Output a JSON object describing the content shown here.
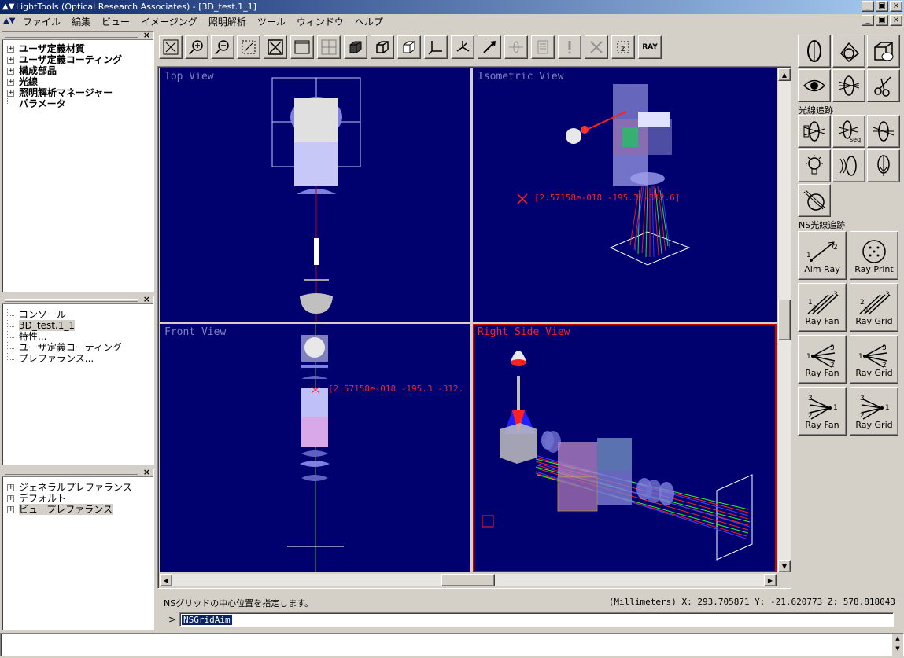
{
  "window": {
    "title": "LightTools (Optical Research Associates) - [3D_test.1_1]",
    "controls": [
      "_",
      "▣",
      "×"
    ]
  },
  "menu": [
    "ファイル",
    "編集",
    "ビュー",
    "イメージング",
    "照明解析",
    "ツール",
    "ウィンドウ",
    "ヘルプ"
  ],
  "tree_top": [
    {
      "label": "ユーザ定義材質",
      "expander": "+",
      "bold": true
    },
    {
      "label": "ユーザ定義コーティング",
      "expander": "+",
      "bold": true
    },
    {
      "label": "構成部品",
      "expander": "+",
      "bold": true
    },
    {
      "label": "光線",
      "expander": "+",
      "bold": true
    },
    {
      "label": "照明解析マネージャー",
      "expander": "+",
      "bold": true
    },
    {
      "label": "パラメータ",
      "expander": "",
      "bold": true
    }
  ],
  "tree_mid": [
    {
      "label": "コンソール"
    },
    {
      "label": "3D_test.1_1"
    },
    {
      "label": "特性..."
    },
    {
      "label": "ユーザ定義コーティング"
    },
    {
      "label": "プレファランス..."
    }
  ],
  "tree_bottom": [
    {
      "label": "ジェネラルプレファランス",
      "expander": "+"
    },
    {
      "label": "デフォルト",
      "expander": "+"
    },
    {
      "label": "ビュープレファランス",
      "expander": "+"
    }
  ],
  "toolbar_icons": [
    "zoom-fit-icon",
    "zoom-in-icon",
    "zoom-out-icon",
    "zoom-window-icon",
    "zoom-all-icon",
    "single-view-icon",
    "four-view-icon",
    "solid-box-icon",
    "wire-box-icon",
    "box-icon",
    "axes-icon",
    "rotate-icon",
    "select-arrow-icon",
    "lens-icon",
    "document-icon",
    "alert-icon",
    "delete-icon",
    "z-icon",
    "ray-icon"
  ],
  "toolbar_ray_label": "RAY",
  "views": {
    "top": "Top View",
    "iso": "Isometric View",
    "front": "Front View",
    "right": "Right Side View"
  },
  "coords_iso": "[2.57158e-018 -195.3 -312.6]",
  "coords_front": "[2.57158e-018 -195.3 -312.",
  "palette": {
    "section_ray": "光線追跡",
    "section_ns": "NS光線追跡",
    "buttons": [
      {
        "label": "Aim Ray"
      },
      {
        "label": "Ray Print"
      },
      {
        "label": "Ray Fan"
      },
      {
        "label": "Ray Grid"
      },
      {
        "label": "Ray Fan"
      },
      {
        "label": "Ray Grid"
      },
      {
        "label": "Ray Fan"
      },
      {
        "label": "Ray Grid"
      }
    ],
    "seq_label": "seq"
  },
  "status": {
    "message": "NSグリッドの中心位置を指定します。",
    "units": "(Millimeters) X: 293.705871 Y: -21.620773 Z: 578.818043"
  },
  "command": {
    "prompt": ">",
    "value": "NSGridAim"
  }
}
